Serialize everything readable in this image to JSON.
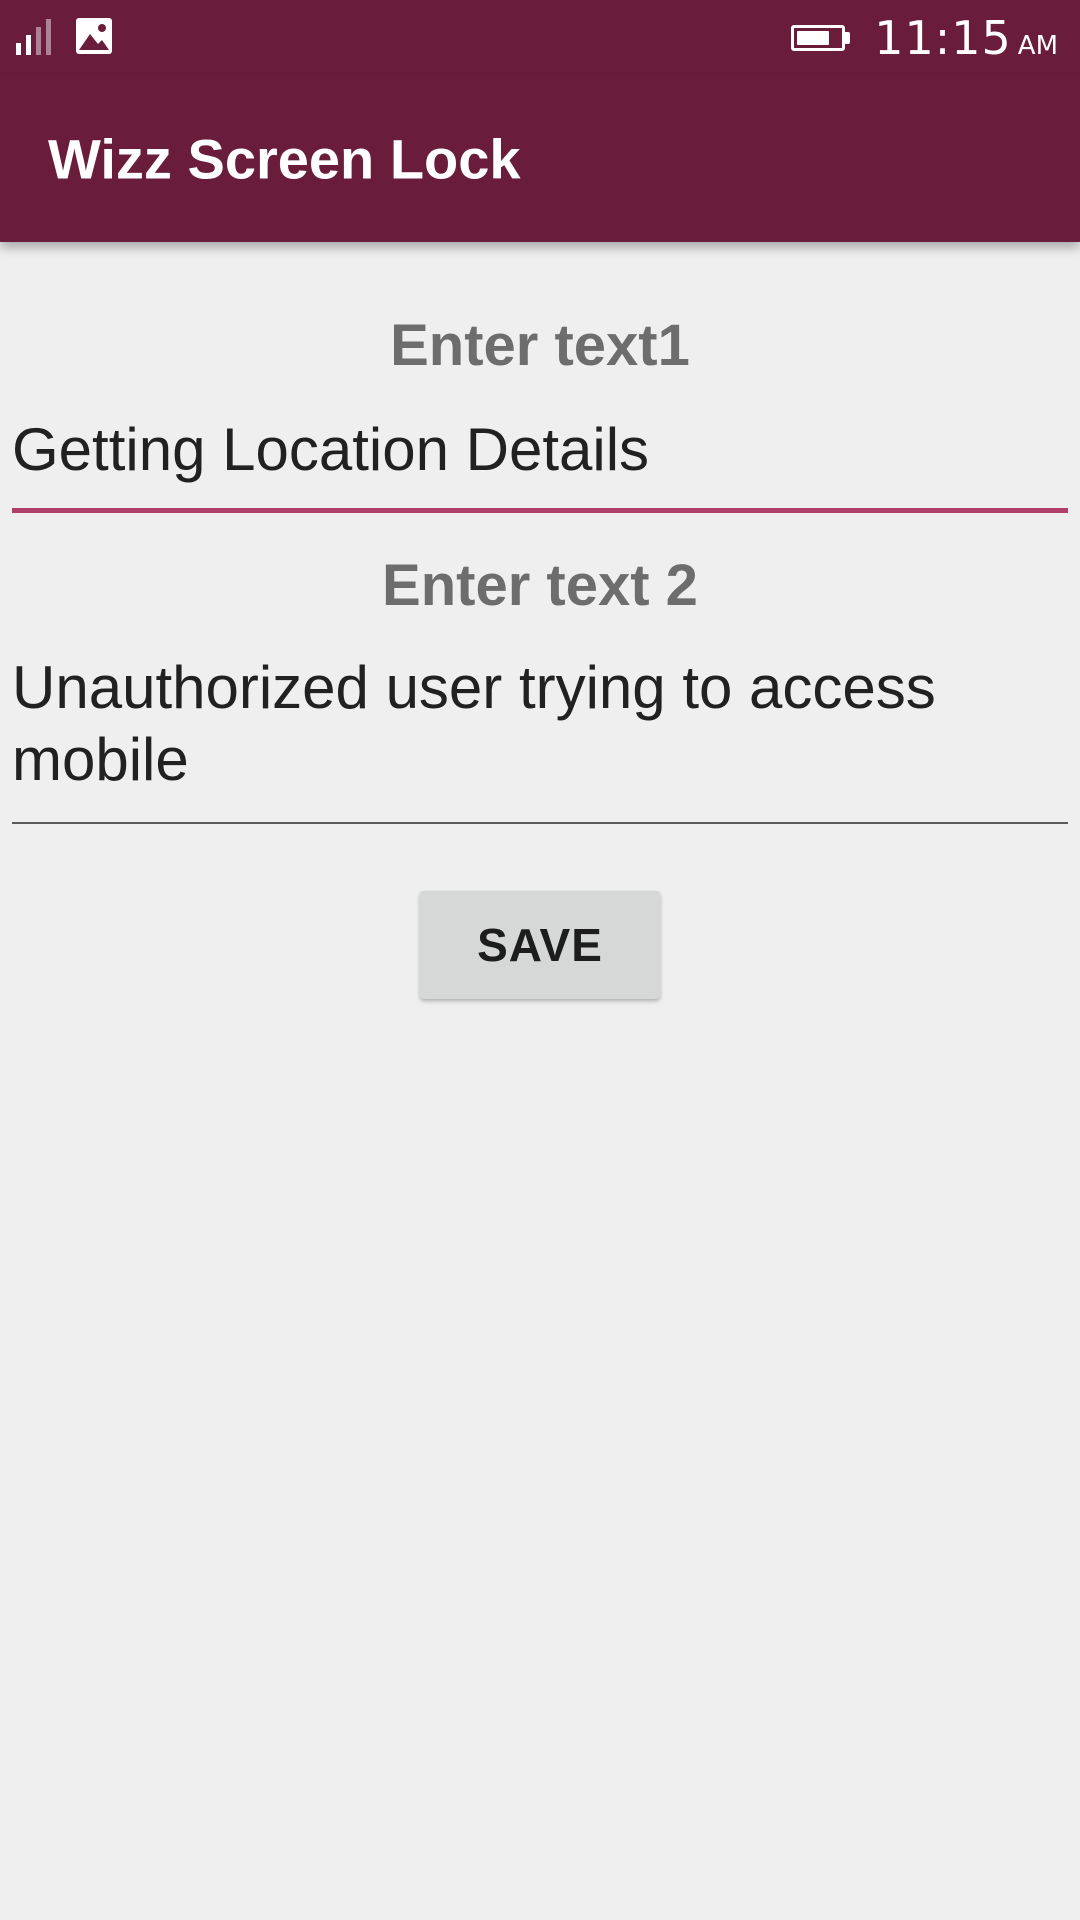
{
  "status_bar": {
    "time": "11:15",
    "ampm": "AM",
    "icons": [
      "signal-icon",
      "image-notification-icon",
      "battery-icon"
    ],
    "battery_level_percent": 75
  },
  "app_bar": {
    "title": "Wizz Screen Lock",
    "color": "#6a1d3b"
  },
  "form": {
    "field1": {
      "label": "Enter text1",
      "value": "Getting Location Details",
      "focused": true
    },
    "field2": {
      "label": "Enter text 2",
      "value": "Unauthorized user trying to access mobile",
      "focused": false
    },
    "save_label": "SAVE"
  },
  "colors": {
    "primary": "#6a1d3b",
    "accent_underline": "#b0406a",
    "background": "#efefef",
    "button": "#d6d7d7"
  }
}
